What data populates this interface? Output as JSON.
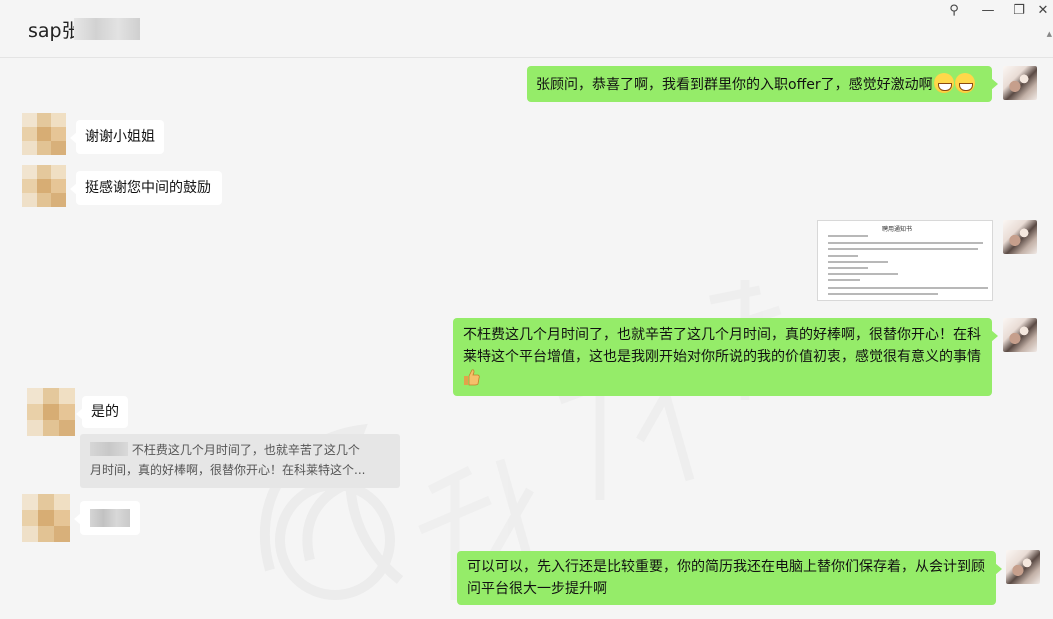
{
  "window": {
    "title": "sap张",
    "controls": [
      "pin-icon",
      "minimize-icon",
      "restore-icon",
      "close-icon"
    ],
    "control_glyphs": {
      "pin": "⚲",
      "minimize": "—",
      "restore": "❐",
      "close": "✕"
    }
  },
  "colors": {
    "outgoing_bubble": "#95ec69",
    "incoming_bubble": "#ffffff",
    "chat_background": "#f5f5f5",
    "quote_background": "#e6e6e6"
  },
  "watermark": {
    "text": "科莱特"
  },
  "messages": [
    {
      "direction": "out",
      "type": "text",
      "text": "张顾问，恭喜了啊，我看到群里你的入职offer了，感觉好激动啊",
      "emojis": [
        "grin-emoji",
        "grin-emoji"
      ]
    },
    {
      "direction": "in",
      "type": "text",
      "text": "谢谢小姐姐"
    },
    {
      "direction": "in",
      "type": "text",
      "text": "挺感谢您中间的鼓励"
    },
    {
      "direction": "out",
      "type": "image",
      "caption": "聘用通知书"
    },
    {
      "direction": "out",
      "type": "text",
      "text_line1": "不枉费这几个月时间了，也就辛苦了这几个月时间，真的好棒啊，很替你开心！在科",
      "text_line2": "莱特这个平台增值，这也是我刚开始对你所说的我的价值初衷，感觉很有意义的事情",
      "emojis": [
        "thumbs-up-emoji"
      ]
    },
    {
      "direction": "in",
      "type": "text",
      "text": "是的",
      "quote_line1": "不枉费这几个月时间了，也就辛苦了这几个",
      "quote_line2": "月时间，真的好棒啊，很替你开心！在科莱特这个..."
    },
    {
      "direction": "in",
      "type": "blurred"
    },
    {
      "direction": "out",
      "type": "text",
      "text_line1": "可以可以，先入行还是比较重要，你的简历我还在电脑上替你们保存着，从会计到顾",
      "text_line2": "问平台很大一步提升啊"
    }
  ]
}
